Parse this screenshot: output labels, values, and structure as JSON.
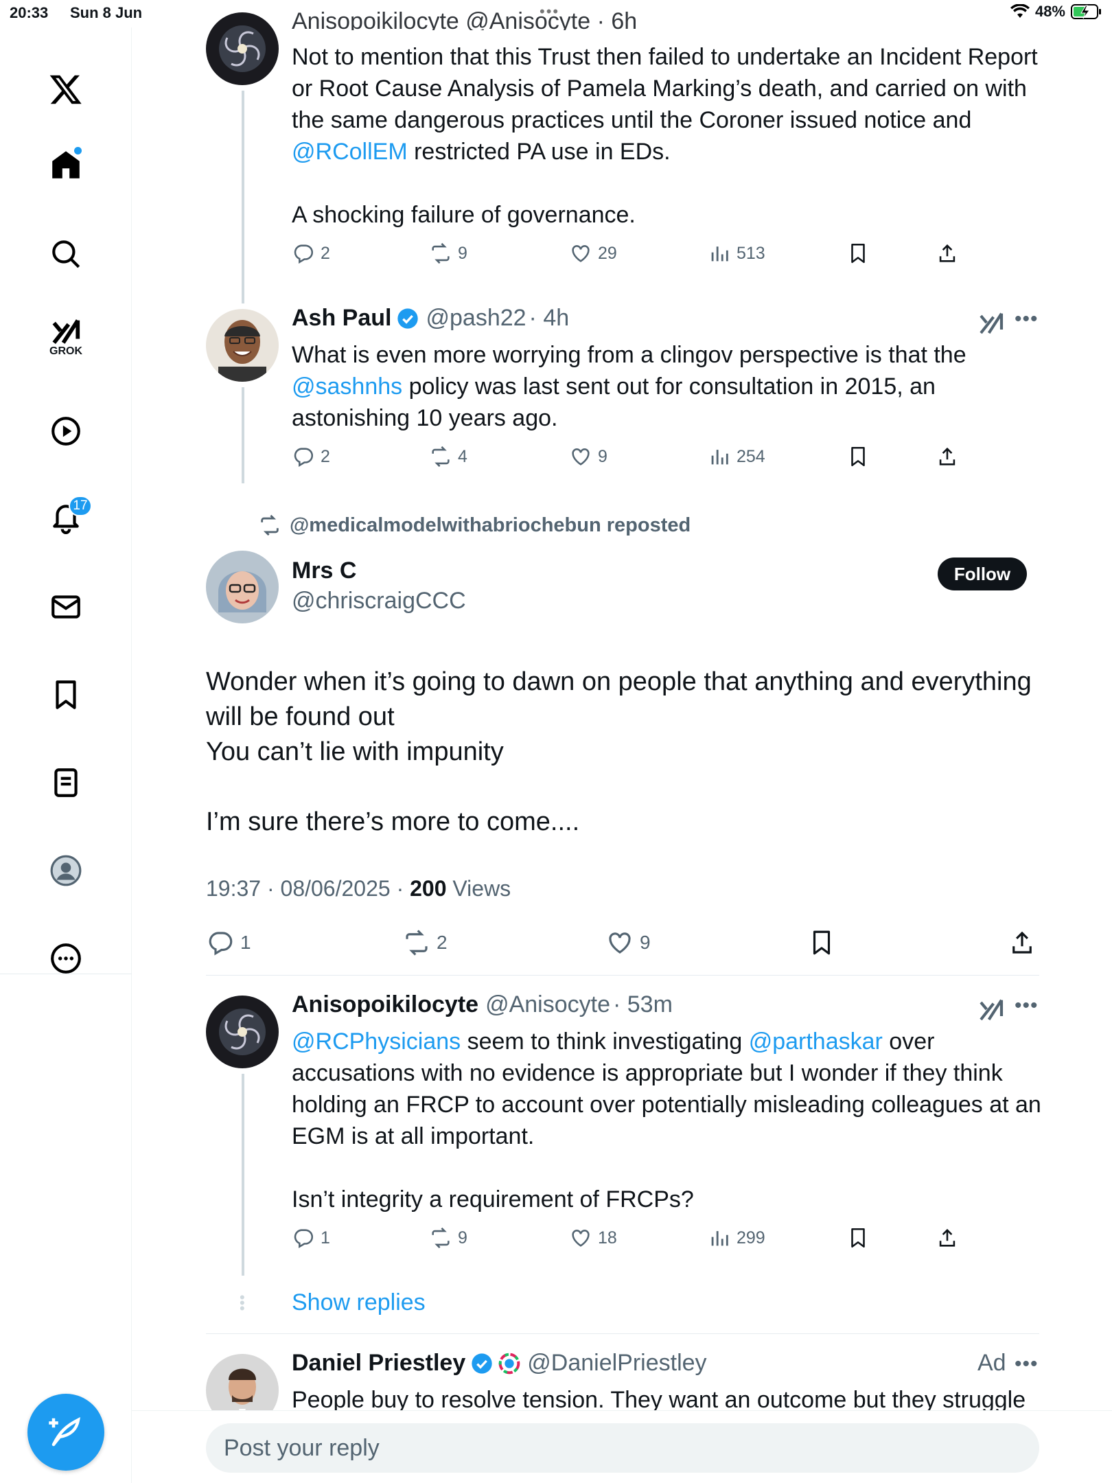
{
  "status_bar": {
    "time": "20:33",
    "date": "Sun 8 Jun",
    "battery": "48%"
  },
  "nav": {
    "grok_label": "GROK",
    "notifications_count": "17"
  },
  "post1": {
    "header_partial": "Anisopoikilocyte @Anisocyte · 6h",
    "text_before": "Not to mention that this Trust then failed to undertake an Incident Report or Root Cause Analysis of Pamela Marking’s death, and carried on with the same dangerous practices until the Coroner issued notice and ",
    "mention": "@RCollEM",
    "text_after": " restricted PA use in EDs.",
    "text2": "A shocking failure of governance.",
    "replies": "2",
    "reposts": "9",
    "likes": "29",
    "views": "513"
  },
  "post2": {
    "name": "Ash Paul",
    "handle": "@pash22",
    "time": "· 4h",
    "text_before": "What is even more worrying from a clingov perspective is that the ",
    "mention": "@sashnhs",
    "text_after": " policy was last sent out for consultation in 2015, an astonishing 10 years ago.",
    "replies": "2",
    "reposts": "4",
    "likes": "9",
    "views": "254"
  },
  "repost_note": "@medicalmodelwithabriochebun reposted",
  "main_post": {
    "name": "Mrs C",
    "handle": "@chriscraigCCC",
    "follow_label": "Follow",
    "line1": "Wonder when it’s going to dawn on people that anything and everything will be found out",
    "line2": "You can’t lie with impunity",
    "line3": "I’m sure there’s more to come....",
    "timestamp": "19:37 · 08/06/2025 · ",
    "views_count": "200",
    "views_label": " Views",
    "replies": "1",
    "reposts": "2",
    "likes": "9"
  },
  "post3": {
    "name": "Anisopoikilocyte",
    "handle": "@Anisocyte",
    "time": "· 53m",
    "mention1": "@RCPhysicians",
    "text1": " seem to think investigating ",
    "mention2": "@parthaskar",
    "text2": " over accusations with no evidence is appropriate but I wonder if they think holding an FRCP to account over potentially misleading colleagues at an EGM is at all important.",
    "text3": "Isn’t integrity a requirement of FRCPs?",
    "replies": "1",
    "reposts": "9",
    "likes": "18",
    "views": "299"
  },
  "show_replies_label": "Show replies",
  "ad_post": {
    "name": "Daniel Priestley",
    "handle": "@DanielPriestley",
    "ad_label": "Ad",
    "text": "People buy to resolve tension. They want an outcome but they struggle"
  },
  "reply": {
    "placeholder": "Post your reply"
  },
  "colors": {
    "accent": "#1d9bf0",
    "text": "#0f1419",
    "secondary": "#536471",
    "border": "#e6ecf0"
  }
}
